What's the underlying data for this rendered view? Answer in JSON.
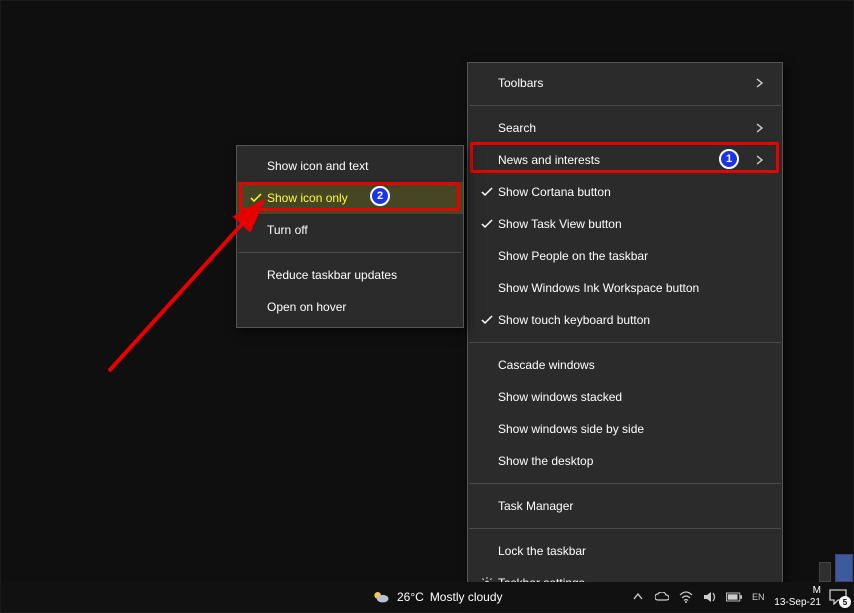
{
  "main_menu": {
    "items": [
      {
        "label": "Toolbars",
        "has_submenu": true
      },
      {
        "label": "Search",
        "has_submenu": true
      },
      {
        "label": "News and interests",
        "has_submenu": true,
        "annot": 1
      },
      {
        "label": "Show Cortana button",
        "checked": true
      },
      {
        "label": "Show Task View button",
        "checked": true
      },
      {
        "label": "Show People on the taskbar"
      },
      {
        "label": "Show Windows Ink Workspace button"
      },
      {
        "label": "Show touch keyboard button",
        "checked": true
      },
      {
        "label": "Cascade windows"
      },
      {
        "label": "Show windows stacked"
      },
      {
        "label": "Show windows side by side"
      },
      {
        "label": "Show the desktop"
      },
      {
        "label": "Task Manager"
      },
      {
        "label": "Lock the taskbar"
      },
      {
        "label": "Taskbar settings",
        "icon": "gear"
      }
    ]
  },
  "sub_menu": {
    "items": [
      {
        "label": "Show icon and text"
      },
      {
        "label": "Show icon only",
        "checked": true,
        "highlight": true,
        "annot": 2
      },
      {
        "label": "Turn off"
      },
      {
        "label": "Reduce taskbar updates"
      },
      {
        "label": "Open on hover"
      }
    ]
  },
  "taskbar": {
    "weather": {
      "temp": "26°C",
      "desc": "Mostly cloudy"
    },
    "clock": {
      "time": "M",
      "date": "13-Sep-21"
    },
    "action_center_count": "5"
  }
}
